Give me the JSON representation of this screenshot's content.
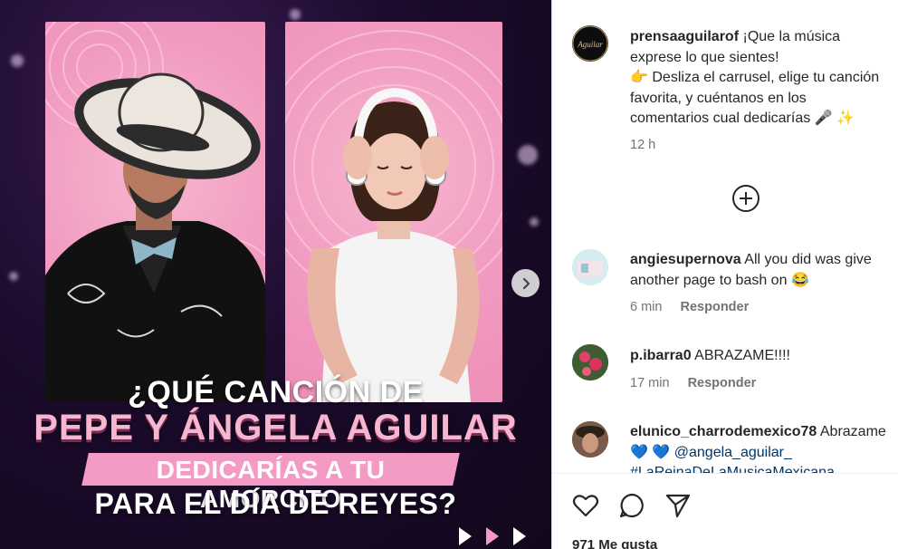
{
  "post": {
    "author": "prensaaguilarof",
    "caption_line1": "¡Que la música",
    "caption_line2": "exprese lo que sientes!",
    "caption_line3": "Desliza el carrusel, elige tu canción",
    "caption_line4": "favorita, y cuéntanos en los",
    "caption_line5": "comentarios cual dedicarías",
    "emoji_point": "👉",
    "emoji_mic": "🎤",
    "emoji_sparkles": "✨",
    "time": "12 h",
    "avatar_text": "Aguilar"
  },
  "media": {
    "title_line1": "¿QUÉ CANCIÓN DE",
    "title_line2": "PEPE Y ÁNGELA AGUILAR",
    "title_line3": "DEDICARÍAS A TU AMORCITO",
    "title_line4": "PARA EL DÍA DE REYES?"
  },
  "comments": [
    {
      "username": "angiesupernova",
      "text_line1": "All you did was give",
      "text_line2": "another page to bash on",
      "emoji": "😂",
      "time": "6 min",
      "reply_label": "Responder"
    },
    {
      "username": "p.ibarra0",
      "text_line1": "ABRAZAME!!!!",
      "time": "17 min",
      "reply_label": "Responder"
    },
    {
      "username": "elunico_charrodemexico78",
      "text_line1": "Abrazame",
      "hearts": "💙 💙",
      "mention": "@angela_aguilar_",
      "hashtag": "#LaReinaDeLaMusicaMexicana"
    }
  ],
  "actions": {
    "likes": "971 Me gusta"
  },
  "colors": {
    "accent_pink": "#f39bc5",
    "link_blue": "#00376b",
    "muted": "#737373"
  }
}
